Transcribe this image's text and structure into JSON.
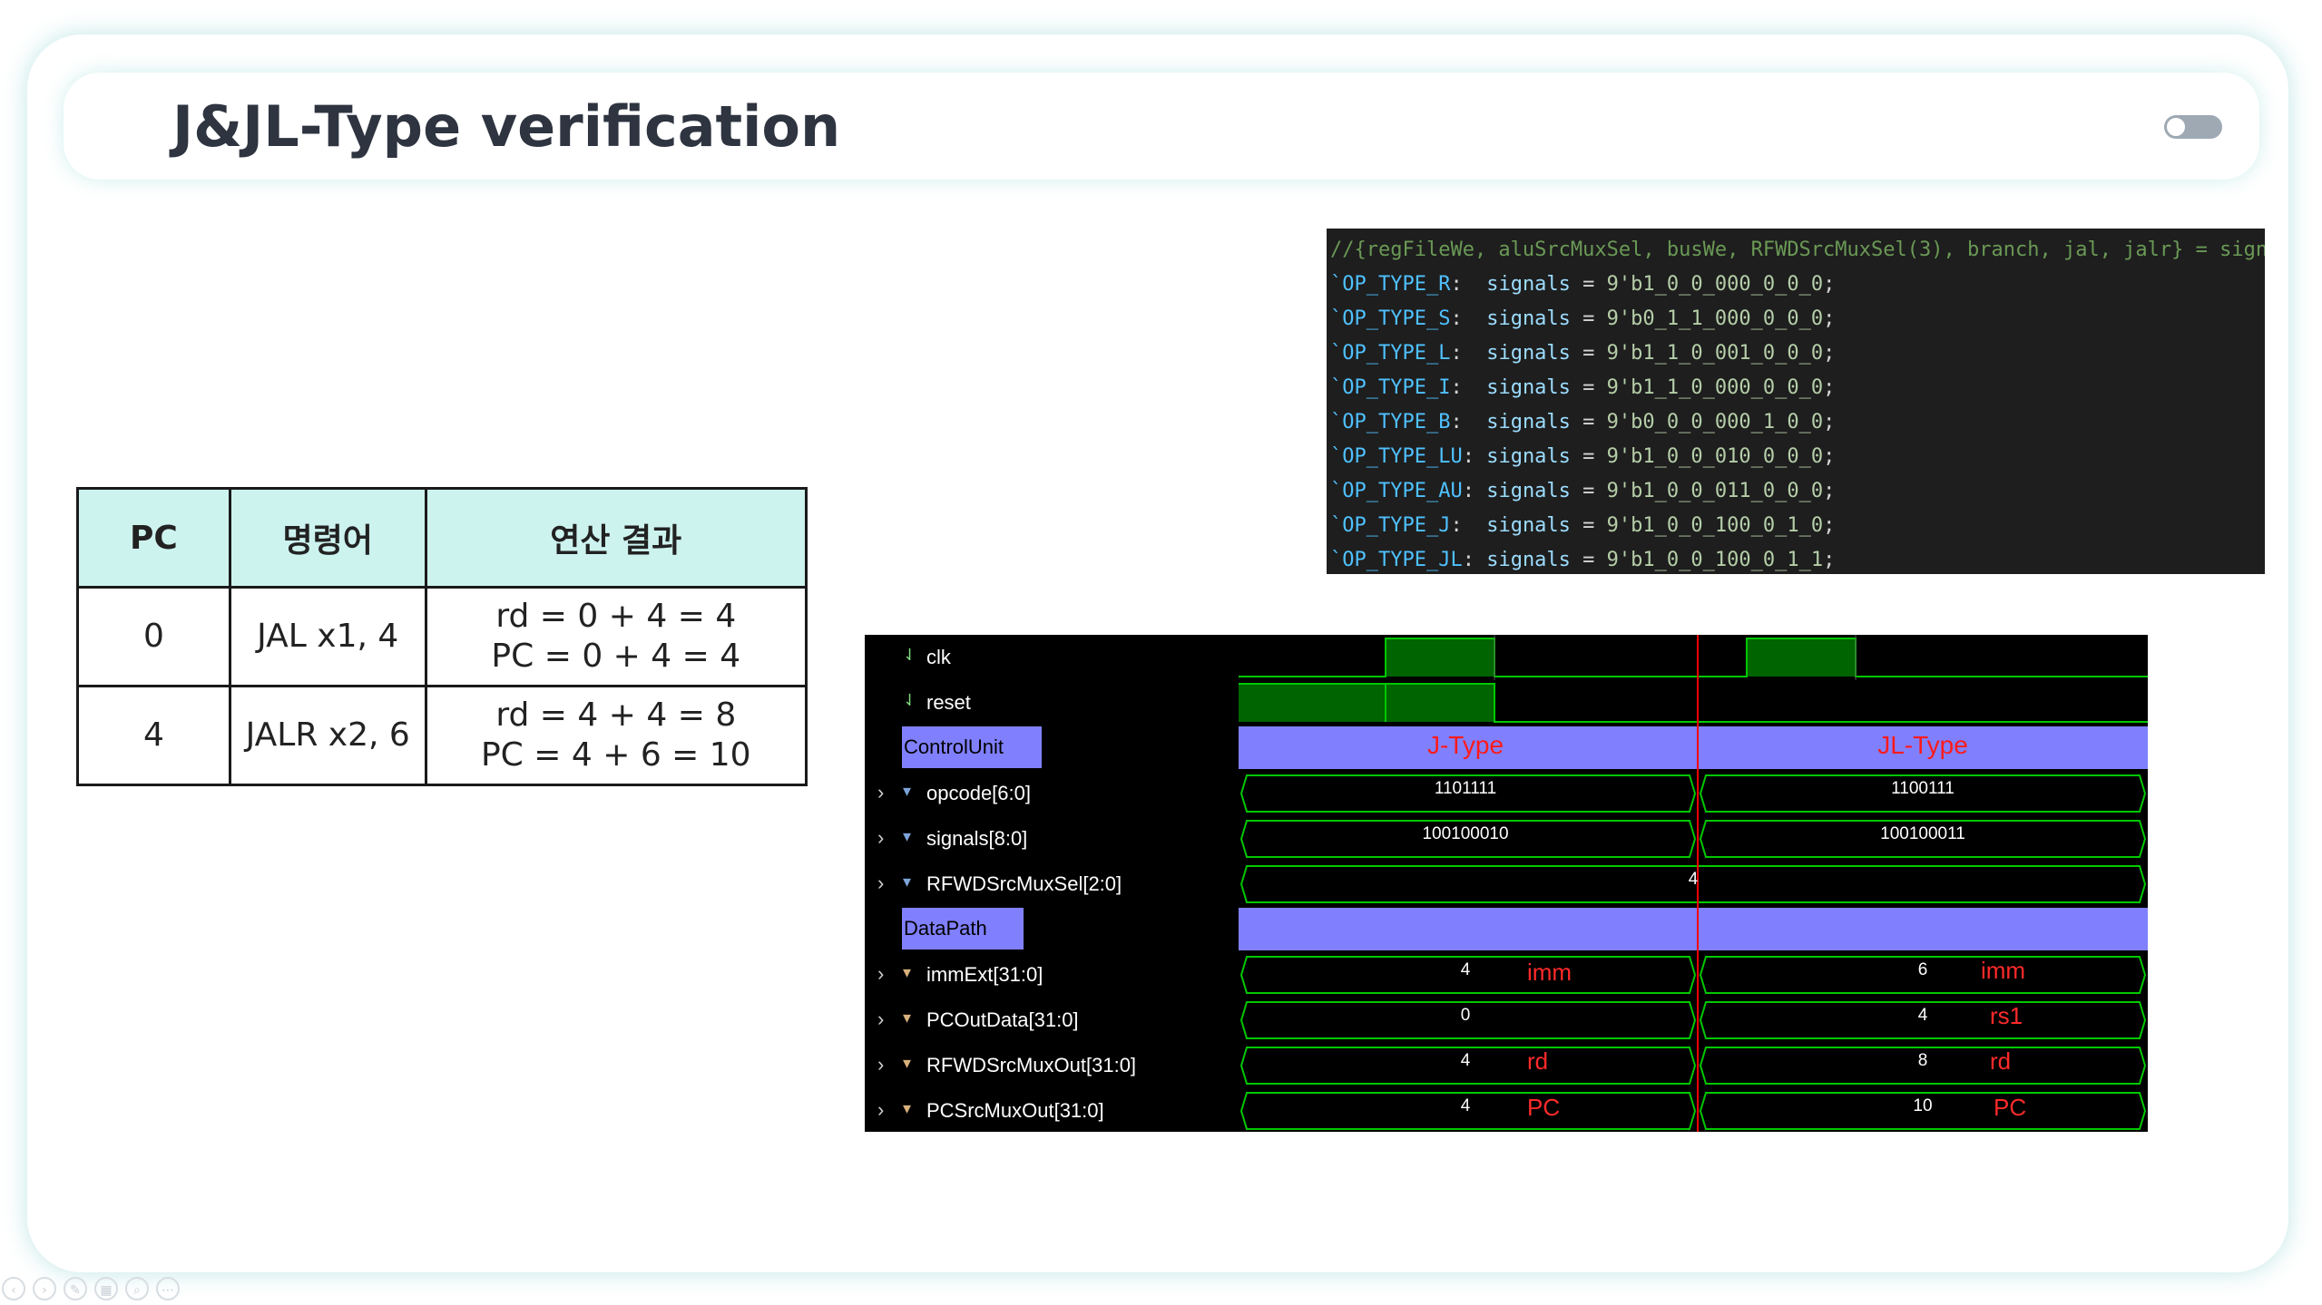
{
  "slide": {
    "title": "J&JL-Type verification"
  },
  "table": {
    "headers": [
      "PC",
      "명령어",
      "연산 결과"
    ],
    "rows": [
      {
        "pc": "0",
        "instr": "JAL x1, 4",
        "res1": "rd = 0 + 4 = 4",
        "res2": "PC = 0 + 4 = 4"
      },
      {
        "pc": "4",
        "instr": "JALR x2, 6",
        "res1": "rd = 4 + 4 = 8",
        "res2": "PC = 4 + 6 = 10"
      }
    ]
  },
  "code": {
    "comment": "//{regFileWe, aluSrcMuxSel, busWe, RFWDSrcMuxSel(3), branch, jal, jalr} = signals;",
    "lines": [
      {
        "op": "`OP_TYPE_R",
        "pad": ":  ",
        "val": "9'b1_0_0_000_0_0_0"
      },
      {
        "op": "`OP_TYPE_S",
        "pad": ":  ",
        "val": "9'b0_1_1_000_0_0_0"
      },
      {
        "op": "`OP_TYPE_L",
        "pad": ":  ",
        "val": "9'b1_1_0_001_0_0_0"
      },
      {
        "op": "`OP_TYPE_I",
        "pad": ":  ",
        "val": "9'b1_1_0_000_0_0_0"
      },
      {
        "op": "`OP_TYPE_B",
        "pad": ":  ",
        "val": "9'b0_0_0_000_1_0_0"
      },
      {
        "op": "`OP_TYPE_LU",
        "pad": ": ",
        "val": "9'b1_0_0_010_0_0_0"
      },
      {
        "op": "`OP_TYPE_AU",
        "pad": ": ",
        "val": "9'b1_0_0_011_0_0_0"
      },
      {
        "op": "`OP_TYPE_J",
        "pad": ":  ",
        "val": "9'b1_0_0_100_0_1_0"
      },
      {
        "op": "`OP_TYPE_JL",
        "pad": ": ",
        "val": "9'b1_0_0_100_0_1_1"
      }
    ],
    "kw": "signals",
    "eq": " = ",
    "semi": ";"
  },
  "wave": {
    "signals": {
      "clk": "clk",
      "reset": "reset",
      "control_group": "ControlUnit",
      "opcode": "opcode[6:0]",
      "signals": "signals[8:0]",
      "rfwd_sel": "RFWDSrcMuxSel[2:0]",
      "datapath_group": "DataPath",
      "immext": "immExt[31:0]",
      "pcout": "PCOutData[31:0]",
      "rfwd_out": "RFWDSrcMuxOut[31:0]",
      "pcsrc_out": "PCSrcMuxOut[31:0]"
    },
    "values": {
      "j_type": "J-Type",
      "jl_type": "JL-Type",
      "opcode_1": "1101111",
      "opcode_2": "1100111",
      "signals_1": "100100010",
      "signals_2": "100100011",
      "rfwd_sel": "4",
      "immext_1": "4",
      "immext_2": "6",
      "pcout_1": "0",
      "pcout_2": "4",
      "rfwd_out_1": "4",
      "rfwd_out_2": "8",
      "pcsrc_1": "4",
      "pcsrc_2": "10"
    },
    "annotations": {
      "imm_1": "imm",
      "imm_2": "imm",
      "rs1": "rs1",
      "rd_1": "rd",
      "rd_2": "rd",
      "pc_1": "PC",
      "pc_2": "PC"
    },
    "colors": {
      "trace": "#00c800",
      "fill": "#006400",
      "group": "#8080ff",
      "cursor": "#ff0000"
    }
  },
  "nav": {
    "icons": [
      "prev-icon",
      "next-icon",
      "pen-icon",
      "grid-icon",
      "zoom-icon",
      "more-icon"
    ]
  }
}
